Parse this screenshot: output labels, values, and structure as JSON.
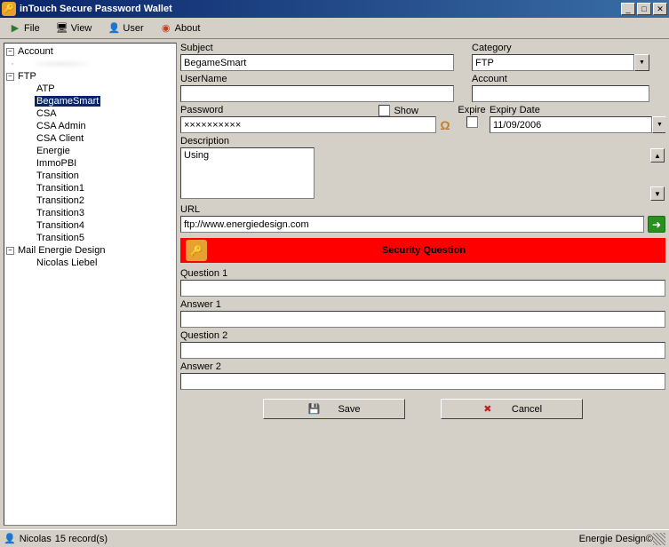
{
  "title": "inTouch Secure Password Wallet",
  "menu": {
    "file": "File",
    "view": "View",
    "user": "User",
    "about": "About"
  },
  "tree": {
    "account": "Account",
    "ftp": "FTP",
    "ftp_children": [
      "ATP",
      "BegameSmart",
      "CSA",
      "CSA Admin",
      "CSA Client",
      "Energie",
      "ImmoPBI",
      "Transition",
      "Transition1",
      "Transition2",
      "Transition3",
      "Transition4",
      "Transition5"
    ],
    "ftp_selected": "BegameSmart",
    "mail": "Mail Energie Design",
    "mail_child": "Nicolas Liebel"
  },
  "form": {
    "subject_lbl": "Subject",
    "subject_val": "BegameSmart",
    "category_lbl": "Category",
    "category_val": "FTP",
    "username_lbl": "UserName",
    "username_val": "",
    "account_lbl": "Account",
    "account_val": "",
    "password_lbl": "Password",
    "password_val": "××××××××××",
    "show_lbl": "Show",
    "expire_lbl": "Expire",
    "expirydate_lbl": "Expiry Date",
    "expirydate_val": "11/09/2006",
    "description_lbl": "Description",
    "description_val": "Using",
    "url_lbl": "URL",
    "url_val": "ftp://www.energiedesign.com",
    "secq_title": "Security Question",
    "q1_lbl": "Question 1",
    "a1_lbl": "Answer 1",
    "q2_lbl": "Question 2",
    "a2_lbl": "Answer 2",
    "save": "Save",
    "cancel": "Cancel"
  },
  "status": {
    "user": "Nicolas",
    "records": "15 record(s)",
    "copyright": "Energie Design©"
  }
}
